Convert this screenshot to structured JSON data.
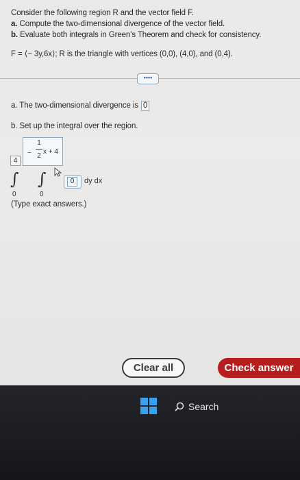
{
  "question": {
    "line1": "Consider the following region R and the vector field F.",
    "line2_prefix": "a.",
    "line2_text": " Compute the two-dimensional divergence of the vector field.",
    "line3_prefix": "b.",
    "line3_text": " Evaluate both integrals in Green's Theorem and check for consistency.",
    "line4": "F = ⟨− 3y,6x⟩; R is the triangle with vertices (0,0), (4,0), and (0,4)."
  },
  "more_button": "••••",
  "part_a": {
    "label": "a. The two-dimensional divergence is",
    "answer": "0"
  },
  "part_b": {
    "label": "b. Set up the integral over the region."
  },
  "integral": {
    "outer_upper": "4",
    "outer_lower": "0",
    "inner_upper_numerator": "1",
    "inner_upper_minus": "−",
    "inner_upper_denominator": "2",
    "inner_upper_tail": "x + 4",
    "inner_lower": "0",
    "integrand": "0",
    "differentials": "dy dx"
  },
  "hint": "(Type exact answers.)",
  "buttons": {
    "clear_all": "Clear all",
    "check_answer": "Check answer"
  },
  "taskbar": {
    "search_label": "Search"
  },
  "colors": {
    "accent_red": "#b81d1d",
    "box_border": "#8aa8c4",
    "windows_blue": "#3aa0f0"
  }
}
